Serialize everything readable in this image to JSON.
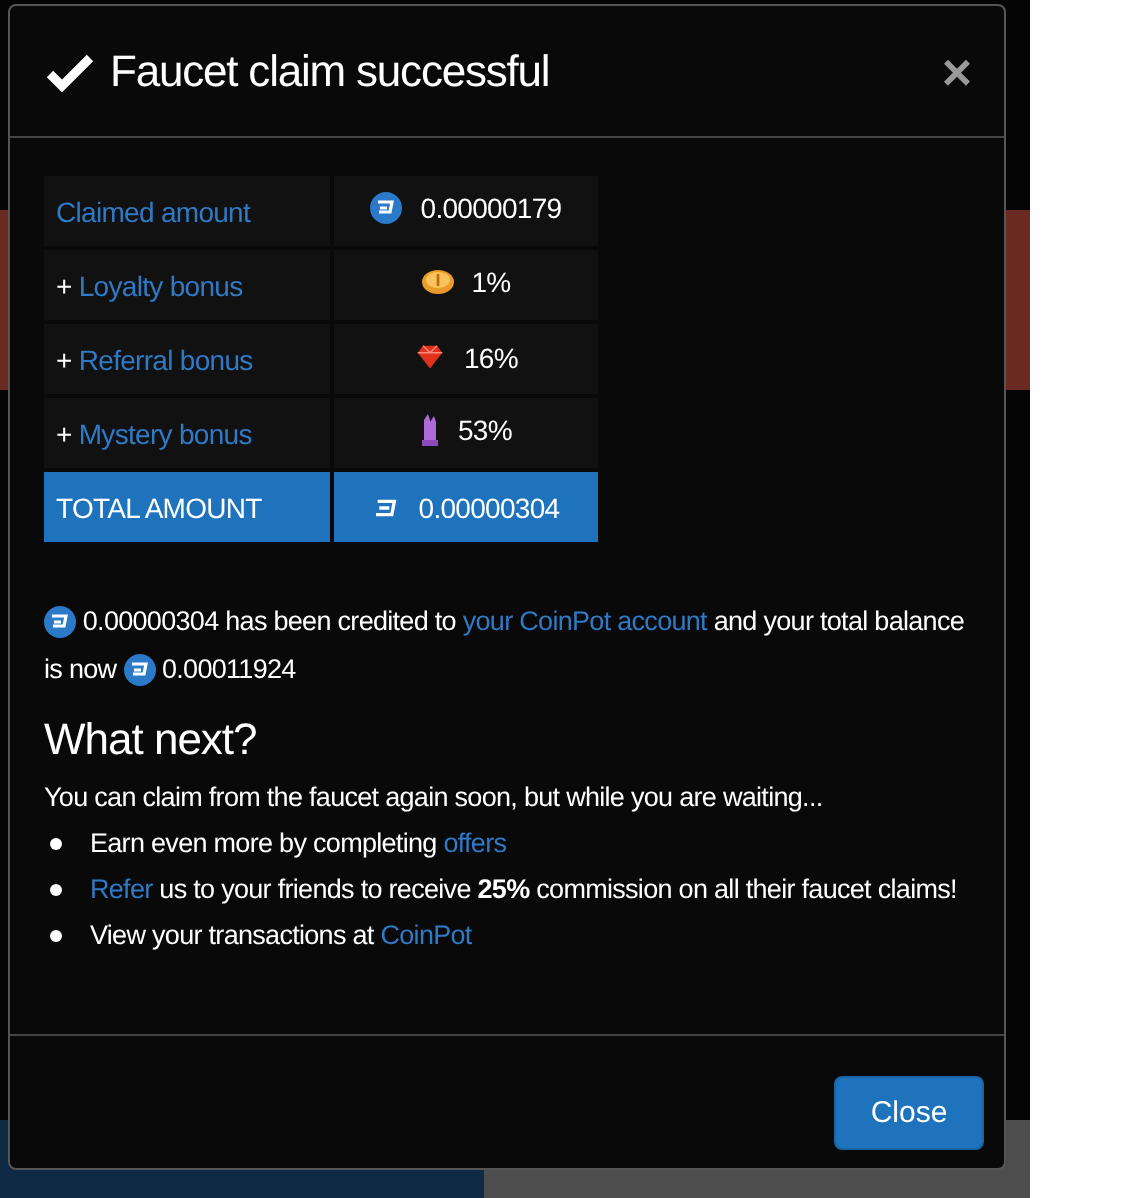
{
  "modal": {
    "title": "Faucet claim successful",
    "close_symbol": "×"
  },
  "claim_table": [
    {
      "kind": "claimed",
      "label": "Claimed amount",
      "value": "0.00000179"
    },
    {
      "kind": "loyalty",
      "prefix": "+",
      "label": "Loyalty bonus",
      "value": "1%"
    },
    {
      "kind": "referral",
      "prefix": "+",
      "label": "Referral bonus",
      "value": "16%"
    },
    {
      "kind": "mystery",
      "prefix": "+",
      "label": "Mystery bonus",
      "value": "53%"
    },
    {
      "kind": "total",
      "label": "TOTAL AMOUNT",
      "value": "0.00000304"
    }
  ],
  "credited_message": {
    "amount": "0.00000304",
    "text_1": "has been credited to",
    "link": "your CoinPot account",
    "text_2": "and your total balance is now",
    "balance": "0.00011924"
  },
  "what_next": {
    "heading": "What next?",
    "intro": "You can claim from the faucet again soon, but while you are waiting...",
    "bullets": [
      [
        {
          "kind": "text",
          "text": "Earn even more by completing "
        },
        {
          "kind": "link",
          "text": "offers"
        }
      ],
      [
        {
          "kind": "link",
          "text": "Refer"
        },
        {
          "kind": "text",
          "text": " us to your friends to receive **25%** commission on all their faucet claims!"
        }
      ],
      [
        {
          "kind": "text",
          "text": "View your transactions at "
        },
        {
          "kind": "link",
          "text": "CoinPot"
        }
      ]
    ]
  },
  "footer": {
    "button": "Close"
  }
}
